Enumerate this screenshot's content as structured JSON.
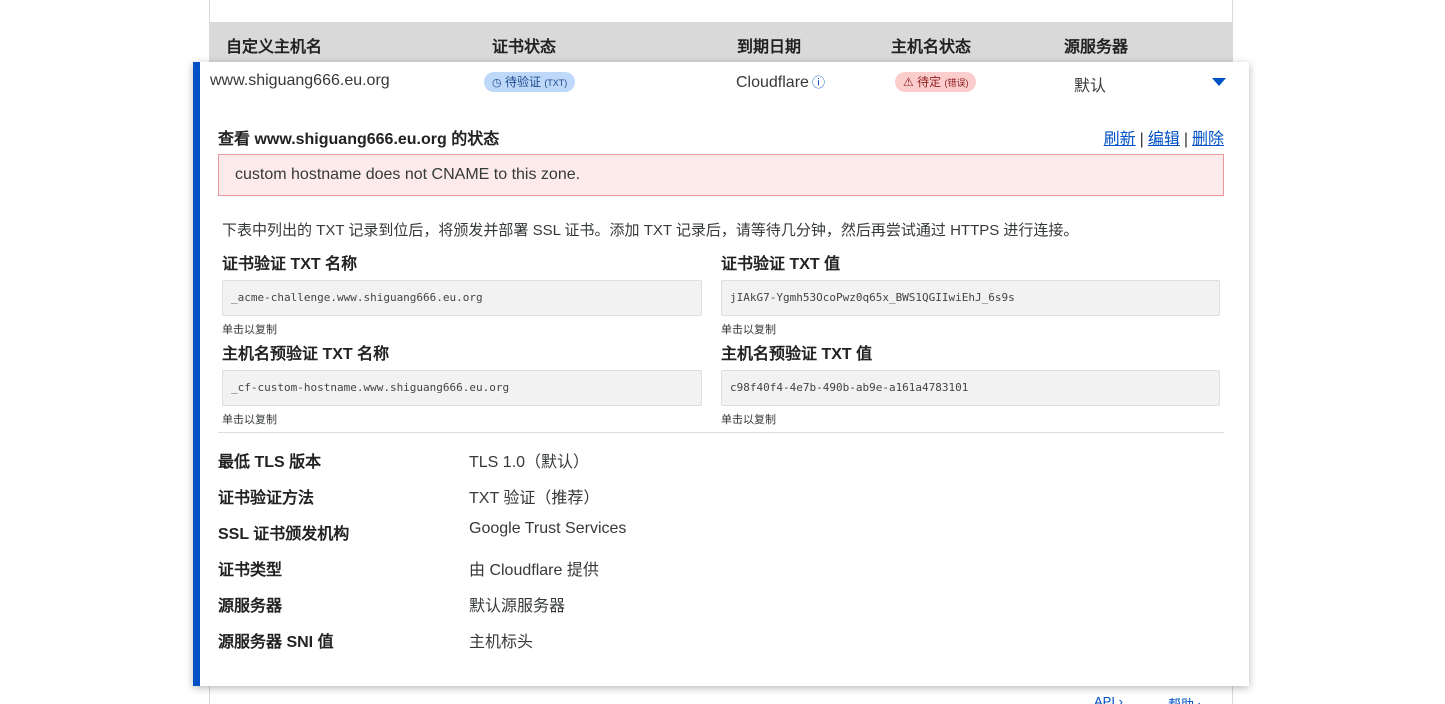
{
  "table": {
    "headers": [
      "自定义主机名",
      "证书状态",
      "到期日期",
      "主机名状态",
      "源服务器"
    ]
  },
  "row": {
    "hostname": "www.shiguang666.eu.org",
    "cert_status_label": "待验证",
    "cert_status_sub": "(TXT)",
    "expiry": "Cloudflare",
    "hostname_status_label": "待定",
    "hostname_status_sub": "(错误)",
    "origin": "默认"
  },
  "panel": {
    "title": "查看 www.shiguang666.eu.org 的状态",
    "actions": {
      "refresh": "刷新",
      "edit": "编辑",
      "delete": "删除",
      "separator": "|"
    },
    "error_message": "custom hostname does not CNAME to this zone.",
    "intro": "下表中列出的 TXT 记录到位后，将颁发并部署 SSL 证书。添加 TXT 记录后，请等待几分钟，然后再尝试通过 HTTPS 进行连接。",
    "fields": {
      "cert_txt_name_label": "证书验证 TXT 名称",
      "cert_txt_name_value": "_acme-challenge.www.shiguang666.eu.org",
      "cert_txt_value_label": "证书验证 TXT 值",
      "cert_txt_value_value": "jIAkG7-Ygmh53OcoPwz0q65x_BWS1QGIIwiEhJ_6s9s",
      "host_txt_name_label": "主机名预验证 TXT 名称",
      "host_txt_name_value": "_cf-custom-hostname.www.shiguang666.eu.org",
      "host_txt_value_label": "主机名预验证 TXT 值",
      "host_txt_value_value": "c98f40f4-4e7b-490b-ab9e-a161a4783101",
      "copy_hint": "单击以复制"
    },
    "details": [
      {
        "label": "最低 TLS 版本",
        "value": "TLS 1.0（默认）"
      },
      {
        "label": "证书验证方法",
        "value": "TXT 验证（推荐）"
      },
      {
        "label": "SSL 证书颁发机构",
        "value": "Google Trust Services"
      },
      {
        "label": "证书类型",
        "value": "由 Cloudflare 提供"
      },
      {
        "label": "源服务器",
        "value": "默认源服务器"
      },
      {
        "label": "源服务器 SNI 值",
        "value": "主机标头"
      }
    ]
  },
  "footer": {
    "api": "API",
    "help": "帮助"
  },
  "colors": {
    "accent": "#0051c3",
    "error_bg": "#fdebeb",
    "error_border": "#e99a9a",
    "header_bg": "#d9d9d9"
  },
  "icons": {
    "cert_status": "clock-icon",
    "hostname_status": "warning-icon",
    "expiry": "info-icon",
    "expand": "caret-down-icon"
  }
}
